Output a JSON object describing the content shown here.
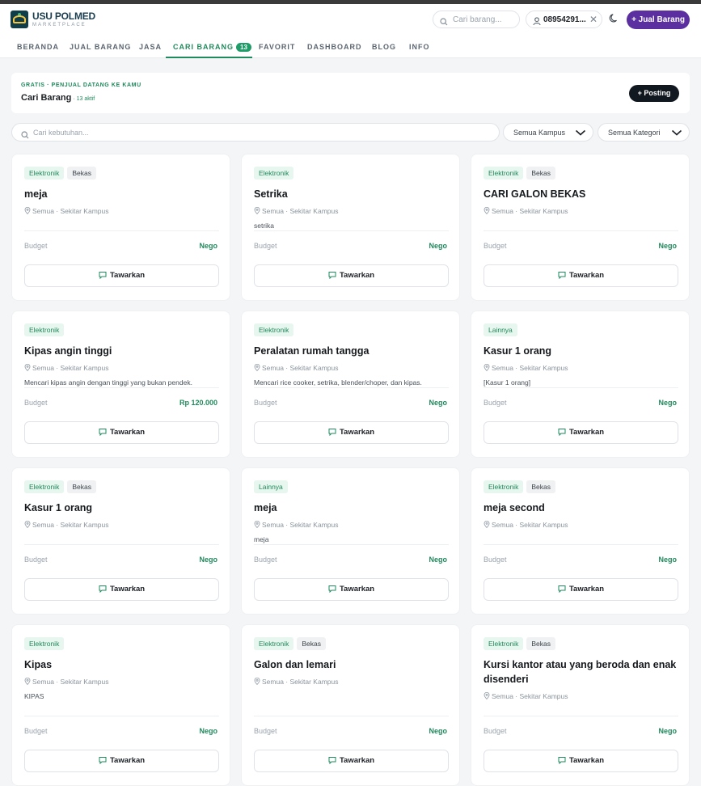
{
  "header": {
    "brand_name": "USU POLMED",
    "brand_sub": "MARKETPLACE",
    "search_placeholder": "Cari barang...",
    "user_phone": "08954291...",
    "sell_button": "+ Jual Barang"
  },
  "nav": {
    "items": [
      "BERANDA",
      "JUAL BARANG",
      "JASA",
      "CARI BARANG",
      "FAVORIT",
      "DASHBOARD",
      "BLOG",
      "INFO"
    ],
    "active_badge": "13"
  },
  "banner": {
    "kicker": "GRATIS · PENJUAL DATANG KE KAMU",
    "title": "Cari Barang",
    "count": "· 13 aktif",
    "post_button": "+ Posting"
  },
  "filters": {
    "search_placeholder": "Cari kebutuhan...",
    "campus": "Semua Kampus",
    "category": "Semua Kategori"
  },
  "card_labels": {
    "location": "Semua · Sekitar Kampus",
    "budget_label": "Budget",
    "offer_button": "Tawarkan"
  },
  "cards": [
    {
      "tags": [
        "Elektronik",
        "Bekas"
      ],
      "title": "meja",
      "desc": "",
      "budget": "Nego"
    },
    {
      "tags": [
        "Elektronik"
      ],
      "title": "Setrika",
      "desc": "setrika",
      "budget": "Nego"
    },
    {
      "tags": [
        "Elektronik",
        "Bekas"
      ],
      "title": "CARI GALON BEKAS",
      "desc": "",
      "budget": "Nego"
    },
    {
      "tags": [
        "Elektronik"
      ],
      "title": "Kipas angin tinggi",
      "desc": "Mencari kipas angin dengan tinggi yang bukan pendek.",
      "budget": "Rp 120.000"
    },
    {
      "tags": [
        "Elektronik"
      ],
      "title": "Peralatan rumah tangga",
      "desc": "Mencari rice cooker, setrika, blender/choper, dan kipas.",
      "budget": "Nego"
    },
    {
      "tags": [
        "Lainnya"
      ],
      "title": "Kasur 1 orang",
      "desc": "[Kasur 1 orang]",
      "budget": "Nego"
    },
    {
      "tags": [
        "Elektronik",
        "Bekas"
      ],
      "title": "Kasur 1 orang",
      "desc": "",
      "budget": "Nego"
    },
    {
      "tags": [
        "Lainnya"
      ],
      "title": "meja",
      "desc": "meja",
      "budget": "Nego"
    },
    {
      "tags": [
        "Elektronik",
        "Bekas"
      ],
      "title": "meja second",
      "desc": "",
      "budget": "Nego"
    },
    {
      "tags": [
        "Elektronik"
      ],
      "title": "Kipas",
      "desc": "KIPAS",
      "budget": "Nego"
    },
    {
      "tags": [
        "Elektronik",
        "Bekas"
      ],
      "title": "Galon dan lemari",
      "desc": "",
      "budget": "Nego"
    },
    {
      "tags": [
        "Elektronik",
        "Bekas"
      ],
      "title": "Kursi kantor atau yang beroda dan enak disenderi",
      "desc": "",
      "budget": "Nego"
    }
  ],
  "colors": {
    "accent_green": "#1f8a5c",
    "brand_purple": "#5b2fa0",
    "dark_button": "#111820"
  }
}
